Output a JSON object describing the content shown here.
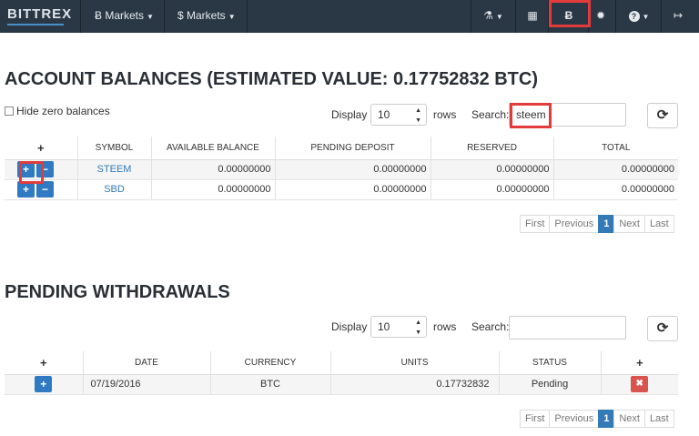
{
  "nav": {
    "brand": "BITTREX",
    "btc_markets": "Ƀ Markets",
    "usd_markets": "$ Markets",
    "lab_icon": "⚗",
    "calendar_icon": "▦",
    "bitcoin_icon": "Ƀ",
    "gear_icon": "✹",
    "help_icon": "?",
    "logout_icon": "↦"
  },
  "balances": {
    "title": "ACCOUNT BALANCES (ESTIMATED VALUE: 0.17752832 BTC)",
    "hide_zero": "Hide zero balances",
    "display_label": "Display",
    "rows_value": "10",
    "rows_label": "rows",
    "search_label": "Search:",
    "search_value": "steem",
    "columns": [
      "+",
      "SYMBOL",
      "AVAILABLE BALANCE",
      "PENDING DEPOSIT",
      "RESERVED",
      "TOTAL"
    ],
    "rows": [
      {
        "symbol": "STEEM",
        "available": "0.00000000",
        "pending": "0.00000000",
        "reserved": "0.00000000",
        "total": "0.00000000"
      },
      {
        "symbol": "SBD",
        "available": "0.00000000",
        "pending": "0.00000000",
        "reserved": "0.00000000",
        "total": "0.00000000"
      }
    ],
    "pager": {
      "first": "First",
      "previous": "Previous",
      "page": "1",
      "next": "Next",
      "last": "Last"
    }
  },
  "withdrawals": {
    "title": "PENDING WITHDRAWALS",
    "display_label": "Display",
    "rows_value": "10",
    "rows_label": "rows",
    "search_label": "Search:",
    "search_value": "",
    "columns": [
      "+",
      "DATE",
      "CURRENCY",
      "UNITS",
      "STATUS",
      "+"
    ],
    "rows": [
      {
        "date": "07/19/2016",
        "currency": "BTC",
        "units": "0.17732832",
        "status": "Pending"
      }
    ],
    "pager": {
      "first": "First",
      "previous": "Previous",
      "page": "1",
      "next": "Next",
      "last": "Last"
    }
  },
  "buttons": {
    "plus": "+",
    "minus": "−",
    "cancel": "✖",
    "refresh": "⟳"
  },
  "colors": {
    "navbar": "#2a3845",
    "accent": "#337ab7",
    "highlight": "#e23b3b",
    "danger": "#d9534f"
  }
}
